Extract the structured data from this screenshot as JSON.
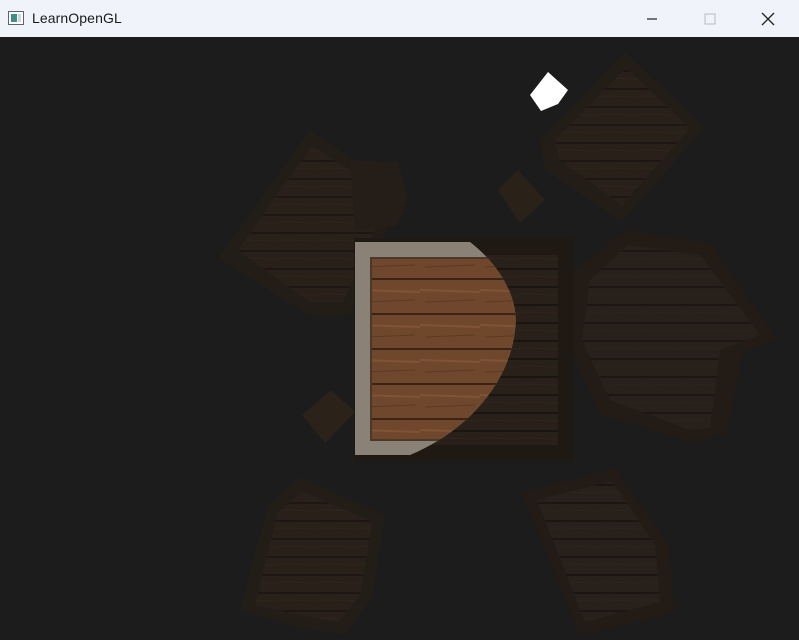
{
  "window": {
    "title": "LearnOpenGL",
    "controls": {
      "minimize_icon": "minimize-icon",
      "maximize_icon": "maximize-icon",
      "close_icon": "close-icon"
    }
  },
  "scene": {
    "background_color": "#1c1c1c",
    "light_color": "#ffffff",
    "wood_color": "#7a4e30",
    "metal_edge_color": "#8c8478",
    "description_objects": [
      "crate",
      "light-cube"
    ]
  }
}
